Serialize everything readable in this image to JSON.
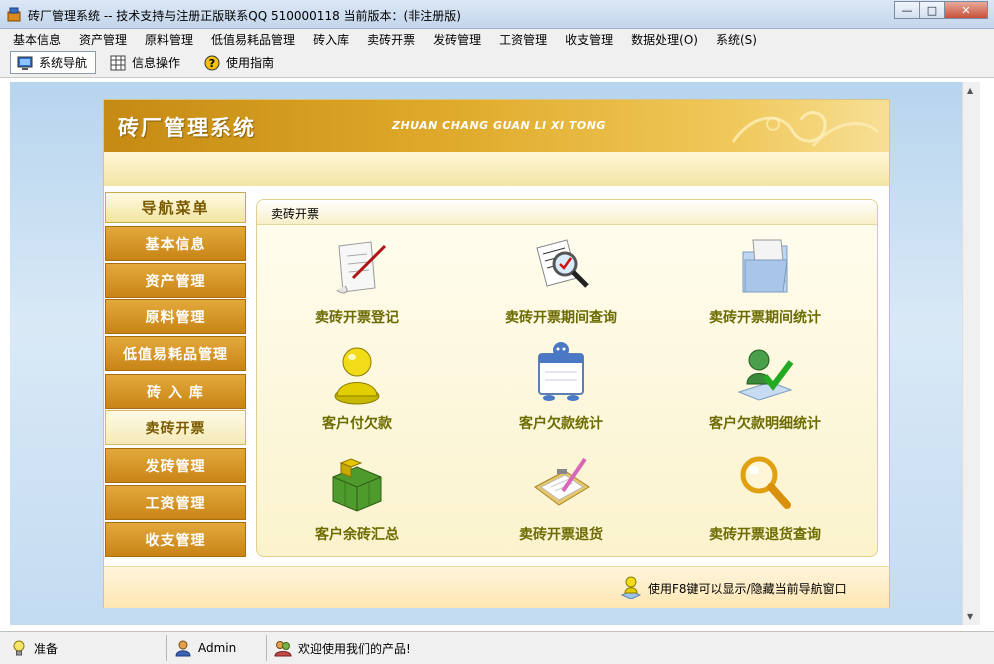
{
  "window": {
    "title": "砖厂管理系统 -- 技术支持与注册正版联系QQ 510000118    当前版本：(非注册版)",
    "minimize": "—",
    "maximize": "□",
    "close": "✕"
  },
  "menu": [
    "基本信息",
    "资产管理",
    "原料管理",
    "低值易耗品管理",
    "砖入库",
    "卖砖开票",
    "发砖管理",
    "工资管理",
    "收支管理",
    "数据处理(O)",
    "系统(S)"
  ],
  "toolbar": {
    "nav_label": "系统导航",
    "info_label": "信息操作",
    "guide_label": "使用指南",
    "guide_icon_glyph": "?"
  },
  "banner": {
    "title": "砖厂管理系统",
    "subtitle": "ZHUAN CHANG GUAN LI XI TONG"
  },
  "nav": {
    "header": "导航菜单",
    "items": [
      "基本信息",
      "资产管理",
      "原料管理",
      "低值易耗品管理",
      "砖 入 库",
      "卖砖开票",
      "发砖管理",
      "工资管理",
      "收支管理"
    ],
    "selected": "卖砖开票"
  },
  "content": {
    "title": "卖砖开票",
    "functions": [
      {
        "label": "卖砖开票登记",
        "icon": "scroll-quill-icon"
      },
      {
        "label": "卖砖开票期间查询",
        "icon": "document-magnifier-icon"
      },
      {
        "label": "卖砖开票期间统计",
        "icon": "folder-document-icon"
      },
      {
        "label": "客户付欠款",
        "icon": "user-icon"
      },
      {
        "label": "客户欠款统计",
        "icon": "calendar-mascot-icon"
      },
      {
        "label": "客户欠款明细统计",
        "icon": "user-check-icon"
      },
      {
        "label": "客户余砖汇总",
        "icon": "green-blocks-icon"
      },
      {
        "label": "卖砖开票退货",
        "icon": "clipboard-pencil-icon"
      },
      {
        "label": "卖砖开票退货查询",
        "icon": "magnifier-icon"
      }
    ]
  },
  "hint": "使用F8键可以显示/隐藏当前导航窗口",
  "status": {
    "ready": "准备",
    "user": "Admin",
    "welcome": "欢迎使用我们的产品!"
  },
  "colors": {
    "banner_gold": "#e0ab2c",
    "nav_orange": "#d4922a",
    "label_olive": "#6b6b00",
    "client_blue": "#c3dbf1"
  }
}
